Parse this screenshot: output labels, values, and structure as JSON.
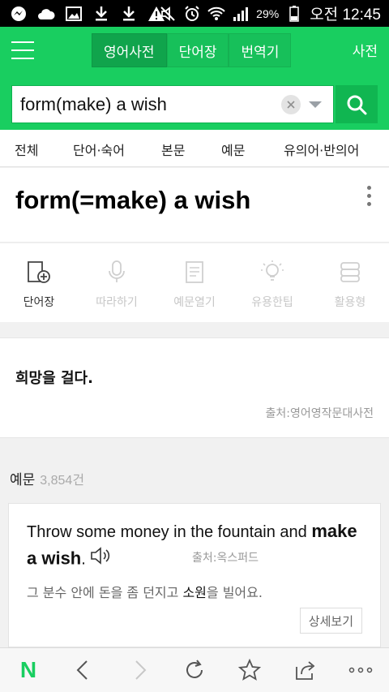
{
  "status_bar": {
    "battery_percent": "29%",
    "time": "오전 12:45",
    "icons": [
      "messenger-icon",
      "cloud-icon",
      "image-icon",
      "download-icon",
      "download-icon",
      "warning-icon",
      "mute-icon",
      "alarm-icon",
      "wifi-icon",
      "signal-icon",
      "battery-icon"
    ]
  },
  "header": {
    "tabs": [
      {
        "label": "영어사전",
        "active": true
      },
      {
        "label": "단어장",
        "active": false
      },
      {
        "label": "번역기",
        "active": false
      }
    ],
    "right_label": "사전"
  },
  "search": {
    "value": "form(make) a wish"
  },
  "filters": [
    "전체",
    "단어·숙어",
    "본문",
    "예문",
    "유의어·반의어"
  ],
  "entry": {
    "title": "form(=make) a wish"
  },
  "actions": [
    {
      "label": "단어장",
      "enabled": true,
      "icon": "add-wordbook-icon"
    },
    {
      "label": "따라하기",
      "enabled": false,
      "icon": "microphone-icon"
    },
    {
      "label": "예문열기",
      "enabled": false,
      "icon": "note-icon"
    },
    {
      "label": "유용한팁",
      "enabled": false,
      "icon": "lightbulb-icon"
    },
    {
      "label": "활용형",
      "enabled": false,
      "icon": "layers-icon"
    }
  ],
  "meaning": {
    "text": "희망을 걸다.",
    "source": "출처:영어영작문대사전"
  },
  "examples": {
    "title": "예문",
    "count": "3,854건",
    "items": [
      {
        "en_before": "Throw some money in the fountain and ",
        "en_bold": "make a wish",
        "en_after": ".",
        "source": "출처:옥스퍼드",
        "ko_before": "그 분수 안에 돈을 좀 던지고 ",
        "ko_bold": "소원",
        "ko_after": "을 빌어요.",
        "detail_label": "상세보기"
      }
    ]
  },
  "colors": {
    "brand_green": "#19ce60",
    "search_button": "#10b651"
  }
}
